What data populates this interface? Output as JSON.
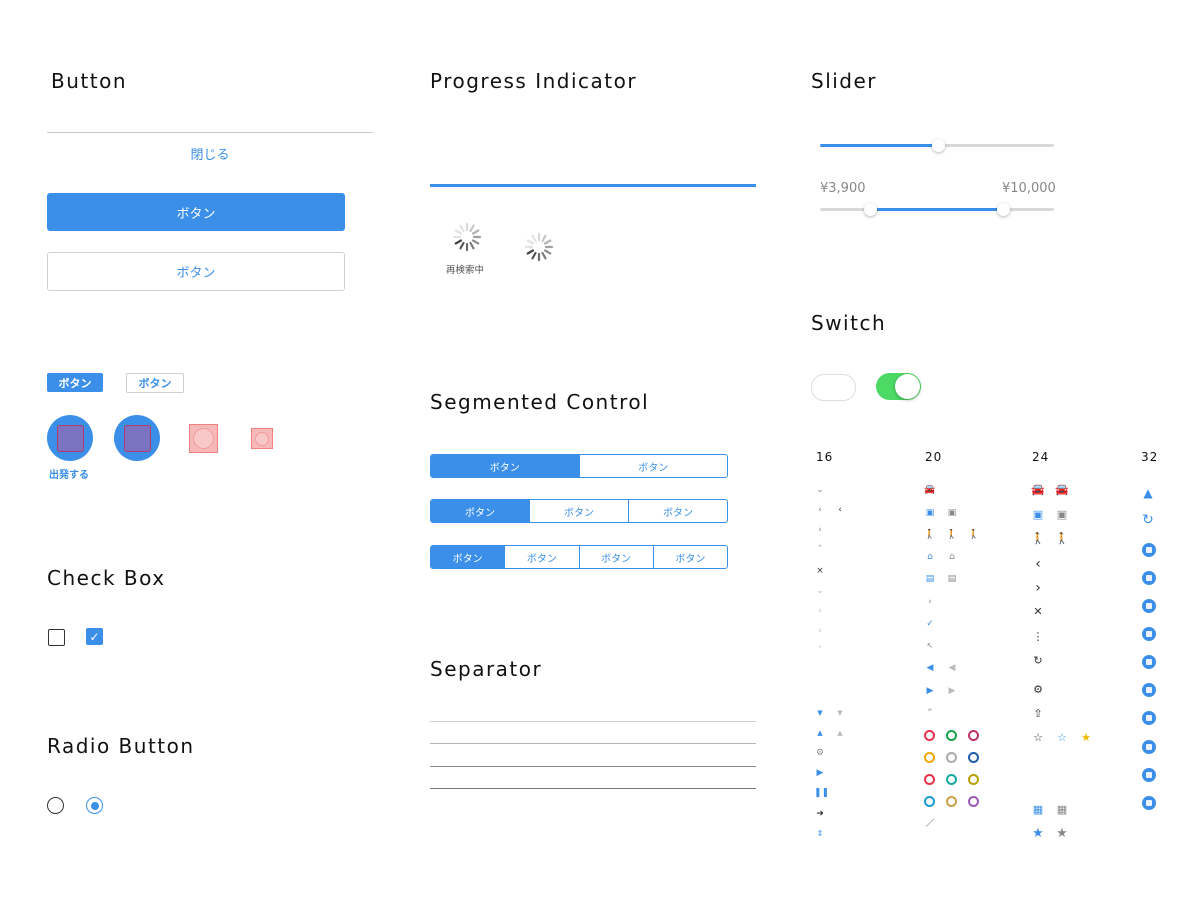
{
  "headings": {
    "button": "Button",
    "progress": "Progress Indicator",
    "slider": "Slider",
    "switch": "Switch",
    "segmented": "Segmented Control",
    "checkbox": "Check Box",
    "radio": "Radio Button",
    "separator": "Separator"
  },
  "buttons": {
    "close": "閉じる",
    "primary": "ボタン",
    "secondary": "ボタン",
    "small_primary": "ボタン",
    "small_secondary": "ボタン",
    "depart": "出発する"
  },
  "progress": {
    "value": 1.0,
    "spinner_label": "再検索中"
  },
  "segmented": {
    "row1": [
      "ボタン",
      "ボタン"
    ],
    "row2": [
      "ボタン",
      "ボタン",
      "ボタン"
    ],
    "row3": [
      "ボタン",
      "ボタン",
      "ボタン",
      "ボタン"
    ],
    "selected_index": 0
  },
  "slider": {
    "single_value": 0.5,
    "range_min_label": "¥3,900",
    "range_max_label": "¥10,000",
    "range_low": 0.22,
    "range_high": 0.78
  },
  "switch": {
    "off_state": false,
    "on_state": true
  },
  "checkbox": {
    "unchecked": false,
    "checked": true
  },
  "radio": {
    "unselected": false,
    "selected": true
  },
  "icon_sizes": [
    "16",
    "20",
    "24",
    "32"
  ],
  "colors": {
    "accent": "#3b8fe8",
    "switch_on": "#4cd964",
    "track": "#d8d8d8",
    "star": "#f5b800"
  }
}
